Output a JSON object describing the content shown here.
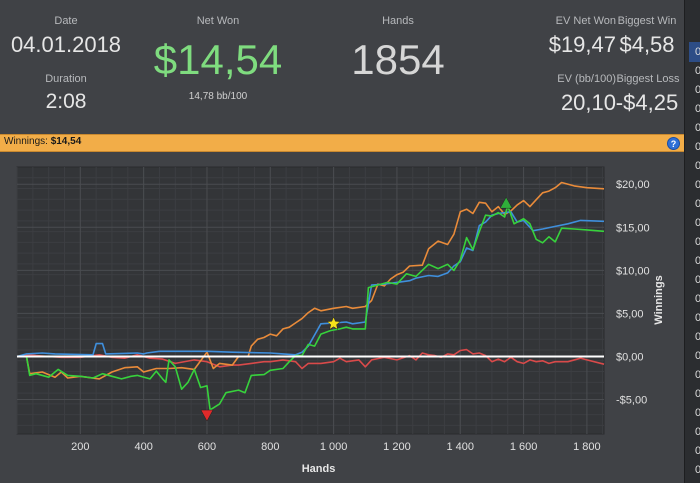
{
  "stats": {
    "date_label": "Date",
    "date_value": "04.01.2018",
    "duration_label": "Duration",
    "duration_value": "2:08",
    "net_won_label": "Net Won",
    "net_won_value": "$14,54",
    "net_won_bb": "14,78 bb/100",
    "hands_label": "Hands",
    "hands_value": "1854",
    "ev_net_won_label": "EV Net Won",
    "ev_net_won_value": "$19,47",
    "biggest_win_label": "Biggest Win",
    "biggest_win_value": "$4,58",
    "ev_bb_label": "EV (bb/100)",
    "ev_bb_value": "20,10",
    "biggest_loss_label": "Biggest Loss",
    "biggest_loss_value": "-$4,25"
  },
  "winnings_bar": {
    "label": "Winnings:",
    "value": "$14,54",
    "help_icon": "?"
  },
  "colors": {
    "net_won": "#7fdc7f",
    "green_line": "#37d23c",
    "blue_line": "#3f8fdc",
    "orange_line": "#e98b3a",
    "red_line": "#d94a4a",
    "accent_bar": "#f2ad48"
  },
  "side_list": [
    "0",
    "0",
    "0",
    "0",
    "0",
    "0",
    "0",
    "0",
    "0",
    "0",
    "0",
    "0",
    "0",
    "0",
    "0",
    "0",
    "0",
    "0",
    "0",
    "0",
    "0",
    "0",
    "0"
  ],
  "chart_data": {
    "type": "line",
    "xlabel": "Hands",
    "ylabel": "Winnings",
    "xlim": [
      0,
      1854
    ],
    "ylim": [
      -9,
      22
    ],
    "x_ticks": [
      200,
      400,
      600,
      800,
      1000,
      1200,
      1400,
      1600,
      1800
    ],
    "x_tick_labels": [
      "200",
      "400",
      "600",
      "800",
      "1 000",
      "1 200",
      "1 400",
      "1 600",
      "1 800"
    ],
    "y_ticks": [
      20,
      15,
      10,
      5,
      0,
      -5
    ],
    "y_tick_labels": [
      "$20,00",
      "$15,00",
      "$10,00",
      "$5,00",
      "$0,00",
      "-$5,00"
    ],
    "markers": [
      {
        "type": "star",
        "x": 1000,
        "y": 3.8,
        "color": "#f6e21a"
      },
      {
        "type": "down-triangle",
        "x": 600,
        "y": -6.8,
        "color": "#e12a2a"
      },
      {
        "type": "up-triangle",
        "x": 1545,
        "y": 17.8,
        "color": "#2fae3a"
      }
    ],
    "series": [
      {
        "color": "#37d23c",
        "points": [
          [
            0,
            0
          ],
          [
            30,
            0
          ],
          [
            40,
            -2.2
          ],
          [
            60,
            -2
          ],
          [
            100,
            -2.4
          ],
          [
            130,
            -1.5
          ],
          [
            160,
            -2.2
          ],
          [
            200,
            -2.3
          ],
          [
            240,
            -2.5
          ],
          [
            270,
            -2
          ],
          [
            300,
            -2.3
          ],
          [
            330,
            -2.6
          ],
          [
            360,
            -2.3
          ],
          [
            380,
            -2.2
          ],
          [
            420,
            -2.6
          ],
          [
            440,
            -1.7
          ],
          [
            460,
            -2.6
          ],
          [
            470,
            -3
          ],
          [
            480,
            -0.4
          ],
          [
            500,
            -1.2
          ],
          [
            520,
            -3.8
          ],
          [
            540,
            -3
          ],
          [
            560,
            -1.5
          ],
          [
            580,
            -3.6
          ],
          [
            600,
            -3.4
          ],
          [
            610,
            -6.2
          ],
          [
            640,
            -5.5
          ],
          [
            660,
            -4.2
          ],
          [
            700,
            -3.9
          ],
          [
            720,
            -4.2
          ],
          [
            740,
            -2.2
          ],
          [
            780,
            -2.1
          ],
          [
            800,
            -1.6
          ],
          [
            840,
            -1.4
          ],
          [
            860,
            -0.6
          ],
          [
            880,
            0.1
          ],
          [
            900,
            0.1
          ],
          [
            920,
            1.4
          ],
          [
            940,
            1.2
          ],
          [
            960,
            2.6
          ],
          [
            990,
            3
          ],
          [
            1020,
            3.2
          ],
          [
            1040,
            3.4
          ],
          [
            1060,
            3.2
          ],
          [
            1100,
            3.2
          ],
          [
            1110,
            8
          ],
          [
            1130,
            8.2
          ],
          [
            1170,
            8.6
          ],
          [
            1200,
            8.4
          ],
          [
            1230,
            9.6
          ],
          [
            1260,
            9.3
          ],
          [
            1300,
            10.7
          ],
          [
            1330,
            10.2
          ],
          [
            1360,
            10.7
          ],
          [
            1380,
            10
          ],
          [
            1400,
            11.2
          ],
          [
            1420,
            13.8
          ],
          [
            1440,
            12.4
          ],
          [
            1460,
            14.5
          ],
          [
            1480,
            16.4
          ],
          [
            1500,
            16.3
          ],
          [
            1520,
            16.7
          ],
          [
            1540,
            16.2
          ],
          [
            1550,
            17.5
          ],
          [
            1570,
            15.4
          ],
          [
            1600,
            16
          ],
          [
            1620,
            15.4
          ],
          [
            1640,
            13.6
          ],
          [
            1660,
            13.2
          ],
          [
            1680,
            13.9
          ],
          [
            1700,
            13.3
          ],
          [
            1720,
            14.9
          ],
          [
            1760,
            14.8
          ],
          [
            1800,
            14.7
          ],
          [
            1854,
            14.54
          ]
        ]
      },
      {
        "color": "#3f8fdc",
        "points": [
          [
            0,
            0
          ],
          [
            30,
            0.3
          ],
          [
            80,
            0.4
          ],
          [
            120,
            0.3
          ],
          [
            240,
            0.2
          ],
          [
            250,
            1.5
          ],
          [
            270,
            1.5
          ],
          [
            280,
            0.3
          ],
          [
            380,
            0.4
          ],
          [
            400,
            0.3
          ],
          [
            410,
            0.4
          ],
          [
            450,
            0.6
          ],
          [
            600,
            0.6
          ],
          [
            680,
            0.5
          ],
          [
            800,
            0.4
          ],
          [
            840,
            0.3
          ],
          [
            880,
            0.2
          ],
          [
            900,
            0.5
          ],
          [
            920,
            1.2
          ],
          [
            960,
            3.8
          ],
          [
            1000,
            3.9
          ],
          [
            1040,
            4
          ],
          [
            1060,
            3.8
          ],
          [
            1100,
            4
          ],
          [
            1120,
            8.3
          ],
          [
            1160,
            8.4
          ],
          [
            1200,
            8.6
          ],
          [
            1240,
            8.8
          ],
          [
            1260,
            9.1
          ],
          [
            1300,
            9.4
          ],
          [
            1330,
            9.3
          ],
          [
            1360,
            9.7
          ],
          [
            1380,
            10.5
          ],
          [
            1400,
            11
          ],
          [
            1420,
            12.6
          ],
          [
            1440,
            12.3
          ],
          [
            1460,
            15.2
          ],
          [
            1480,
            15.6
          ],
          [
            1500,
            16.4
          ],
          [
            1520,
            16.6
          ],
          [
            1560,
            16.8
          ],
          [
            1580,
            15.6
          ],
          [
            1600,
            15.8
          ],
          [
            1630,
            14.6
          ],
          [
            1660,
            14.8
          ],
          [
            1700,
            15.1
          ],
          [
            1740,
            15.4
          ],
          [
            1780,
            15.8
          ],
          [
            1854,
            15.7
          ]
        ]
      },
      {
        "color": "#e98b3a",
        "points": [
          [
            0,
            0
          ],
          [
            30,
            0
          ],
          [
            40,
            -2
          ],
          [
            80,
            -1.8
          ],
          [
            120,
            -2.4
          ],
          [
            140,
            -1.8
          ],
          [
            160,
            -2.5
          ],
          [
            200,
            -2.3
          ],
          [
            260,
            -2.6
          ],
          [
            300,
            -1.8
          ],
          [
            340,
            -1.3
          ],
          [
            380,
            -1.2
          ],
          [
            400,
            -1.8
          ],
          [
            440,
            -1.4
          ],
          [
            480,
            -1.4
          ],
          [
            520,
            -1.3
          ],
          [
            560,
            -1.5
          ],
          [
            600,
            0.5
          ],
          [
            620,
            -1.4
          ],
          [
            640,
            -0.8
          ],
          [
            680,
            -1
          ],
          [
            700,
            0
          ],
          [
            730,
            0
          ],
          [
            740,
            1.2
          ],
          [
            760,
            2
          ],
          [
            780,
            2.2
          ],
          [
            800,
            2.6
          ],
          [
            820,
            2.4
          ],
          [
            840,
            3.2
          ],
          [
            860,
            3.4
          ],
          [
            880,
            3.9
          ],
          [
            900,
            4.4
          ],
          [
            920,
            5.1
          ],
          [
            940,
            5.6
          ],
          [
            960,
            5.3
          ],
          [
            1000,
            5.6
          ],
          [
            1040,
            5.8
          ],
          [
            1060,
            5.6
          ],
          [
            1100,
            5.8
          ],
          [
            1120,
            6.5
          ],
          [
            1140,
            8.4
          ],
          [
            1160,
            8.2
          ],
          [
            1180,
            9
          ],
          [
            1200,
            9.5
          ],
          [
            1220,
            9.8
          ],
          [
            1240,
            10.5
          ],
          [
            1280,
            10.6
          ],
          [
            1300,
            12.5
          ],
          [
            1330,
            13.4
          ],
          [
            1360,
            13
          ],
          [
            1380,
            14.2
          ],
          [
            1400,
            16.8
          ],
          [
            1420,
            17.1
          ],
          [
            1440,
            16.6
          ],
          [
            1460,
            17.9
          ],
          [
            1480,
            17.8
          ],
          [
            1500,
            16.8
          ],
          [
            1520,
            17.4
          ],
          [
            1540,
            16.5
          ],
          [
            1560,
            16.9
          ],
          [
            1580,
            17.6
          ],
          [
            1600,
            18.1
          ],
          [
            1620,
            17.4
          ],
          [
            1640,
            18.2
          ],
          [
            1660,
            19
          ],
          [
            1680,
            19.2
          ],
          [
            1700,
            19.6
          ],
          [
            1720,
            20.2
          ],
          [
            1760,
            19.8
          ],
          [
            1800,
            19.6
          ],
          [
            1854,
            19.47
          ]
        ]
      },
      {
        "color": "#d94a4a",
        "points": [
          [
            0,
            0
          ],
          [
            40,
            0.2
          ],
          [
            60,
            0.1
          ],
          [
            100,
            0
          ],
          [
            140,
            -0.1
          ],
          [
            200,
            -0.1
          ],
          [
            260,
            0.2
          ],
          [
            300,
            -0.1
          ],
          [
            340,
            -0.2
          ],
          [
            380,
            0.2
          ],
          [
            420,
            -0.2
          ],
          [
            460,
            -0.3
          ],
          [
            500,
            -0.8
          ],
          [
            560,
            -0.4
          ],
          [
            600,
            -0.6
          ],
          [
            640,
            -1.2
          ],
          [
            680,
            -1
          ],
          [
            700,
            -1
          ],
          [
            740,
            -0.8
          ],
          [
            780,
            -0.6
          ],
          [
            800,
            -0.6
          ],
          [
            840,
            -0.4
          ],
          [
            880,
            -0.6
          ],
          [
            900,
            -1.4
          ],
          [
            920,
            -0.8
          ],
          [
            960,
            -0.8
          ],
          [
            1000,
            -0.6
          ],
          [
            1020,
            -0.2
          ],
          [
            1040,
            -0.6
          ],
          [
            1080,
            -0.4
          ],
          [
            1100,
            -1.2
          ],
          [
            1120,
            -0.4
          ],
          [
            1160,
            -0.1
          ],
          [
            1200,
            -0.4
          ],
          [
            1240,
            0.1
          ],
          [
            1260,
            -0.4
          ],
          [
            1280,
            0.4
          ],
          [
            1300,
            0.2
          ],
          [
            1320,
            0.1
          ],
          [
            1340,
            -0.1
          ],
          [
            1360,
            0.3
          ],
          [
            1380,
            0.2
          ],
          [
            1400,
            0.7
          ],
          [
            1420,
            0.8
          ],
          [
            1440,
            0.3
          ],
          [
            1460,
            0.4
          ],
          [
            1480,
            0.1
          ],
          [
            1500,
            -0.6
          ],
          [
            1520,
            -0.3
          ],
          [
            1540,
            -0.6
          ],
          [
            1560,
            -0.1
          ],
          [
            1580,
            -0.6
          ],
          [
            1600,
            -0.8
          ],
          [
            1620,
            -0.4
          ],
          [
            1640,
            -0.6
          ],
          [
            1660,
            -0.5
          ],
          [
            1680,
            -0.8
          ],
          [
            1700,
            -0.6
          ],
          [
            1740,
            -0.6
          ],
          [
            1780,
            -0.2
          ],
          [
            1800,
            -0.4
          ],
          [
            1854,
            -0.9
          ]
        ]
      }
    ]
  }
}
